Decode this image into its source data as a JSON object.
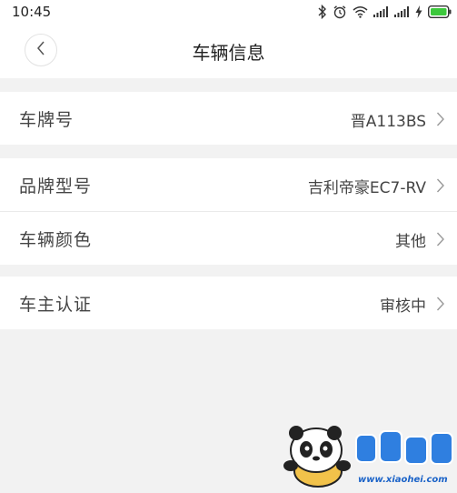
{
  "status_bar": {
    "time": "10:45",
    "icons": [
      "bluetooth-icon",
      "alarm-icon",
      "wifi-icon",
      "signal-icon",
      "signal-icon",
      "charging-icon",
      "battery-icon"
    ]
  },
  "header": {
    "title": "车辆信息",
    "back_icon": "chevron-left-icon"
  },
  "rows": [
    {
      "label": "车牌号",
      "value": "晋A113BS"
    },
    {
      "label": "品牌型号",
      "value": "吉利帝豪EC7-RV"
    },
    {
      "label": "车辆颜色",
      "value": "其他"
    },
    {
      "label": "车主认证",
      "value": "审核中"
    }
  ],
  "watermark": {
    "logo_text": "小黑游戏",
    "url": "www.xiaohei.com"
  },
  "colors": {
    "background": "#f2f2f2",
    "row_background": "#ffffff",
    "battery": "#3cc83c",
    "watermark_blue": "#1b63c8"
  }
}
